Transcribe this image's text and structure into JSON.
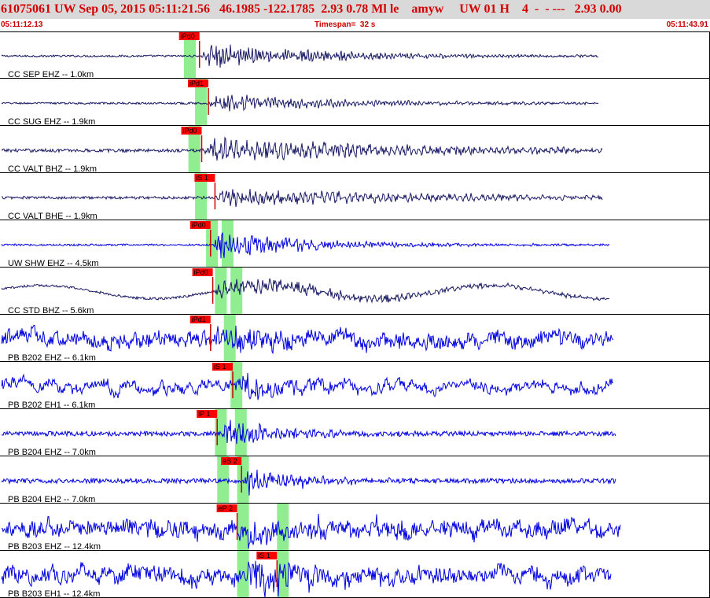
{
  "header": {
    "title": "61075061 UW Sep 05, 2015 05:11:21.56   46.1985 -122.1785  2.93 0.78 Ml le    amyw     UW 01 H    4  -  - ---   2.93 0.00"
  },
  "time_axis": {
    "start_time": "05:11:12.13",
    "timespan_label": "Timespan=  32 s",
    "end_time": "05:11:43.91",
    "span_seconds": 32
  },
  "colors": {
    "title_bg": "#d9d9d9",
    "title_text": "#d40000",
    "trace_blue": "#0000e0",
    "trace_navy": "#1a1a66",
    "pick_box": "#ff0000",
    "pick_line": "#cc0000",
    "window_green": "#90ee90"
  },
  "channels": [
    {
      "label": "CC SEP EHZ -- 1.0km",
      "trace_color": "navy",
      "pick": {
        "label": "iPd0",
        "t": 9.0
      },
      "onset": 9.0,
      "end": 27.0,
      "noise": 0.04,
      "sig": 0.45,
      "decay": 0.16,
      "freq": 6.0,
      "lp_amp": 0.0,
      "windows": [
        8.3
      ]
    },
    {
      "label": "CC SUG EHZ -- 1.9km",
      "trace_color": "navy",
      "pick": {
        "label": "iPd1",
        "t": 9.4
      },
      "onset": 9.4,
      "end": 27.0,
      "noise": 0.04,
      "sig": 0.35,
      "decay": 0.16,
      "freq": 6.0,
      "lp_amp": 0.0,
      "windows": [
        8.8
      ]
    },
    {
      "label": "CC VALT BHZ -- 1.9km",
      "trace_color": "navy",
      "pick": {
        "label": "iPd0",
        "t": 9.1
      },
      "onset": 9.1,
      "end": 27.2,
      "noise": 0.07,
      "sig": 0.45,
      "decay": 0.1,
      "freq": 4.0,
      "lp_amp": 0.0,
      "windows": [
        8.5
      ]
    },
    {
      "label": "CC VALT BHE -- 1.9km",
      "trace_color": "navy",
      "pick": {
        "label": "iS 1",
        "t": 9.7
      },
      "onset": 9.7,
      "end": 27.2,
      "noise": 0.06,
      "sig": 0.35,
      "decay": 0.1,
      "freq": 4.0,
      "lp_amp": 0.0,
      "windows": [
        8.8
      ]
    },
    {
      "label": "UW SHW EHZ -- 4.5km",
      "trace_color": "blue",
      "pick": {
        "label": "iPd0",
        "t": 9.5
      },
      "onset": 9.5,
      "end": 27.5,
      "noise": 0.04,
      "sig": 0.55,
      "decay": 0.22,
      "freq": 6.0,
      "lp_amp": 0.0,
      "windows": [
        9.3,
        10.0
      ]
    },
    {
      "label": "CC STD BHZ -- 5.6km",
      "trace_color": "navy",
      "pick": {
        "label": "iPd0",
        "t": 9.6
      },
      "onset": 9.6,
      "end": 27.5,
      "noise": 0.05,
      "sig": 0.35,
      "decay": 0.12,
      "freq": 4.0,
      "lp_amp": 0.28,
      "windows": [
        9.7,
        10.4
      ]
    },
    {
      "label": "PB B202 EHZ -- 6.1km",
      "trace_color": "blue",
      "pick": {
        "label": "iPd1",
        "t": 9.5
      },
      "onset": 9.6,
      "end": 27.7,
      "noise": 0.25,
      "sig": 0.55,
      "decay": 0.35,
      "freq": 5.0,
      "lp_amp": 0.0,
      "windows": [
        10.1
      ]
    },
    {
      "label": "PB B202 EH1 -- 6.1km",
      "trace_color": "blue",
      "pick": {
        "label": "iS 1",
        "t": 10.5
      },
      "onset": 10.5,
      "end": 27.7,
      "noise": 0.15,
      "sig": 0.55,
      "decay": 0.35,
      "freq": 5.0,
      "lp_amp": 0.0,
      "windows": [
        10.4
      ]
    },
    {
      "label": "PB B204 EHZ -- 7.0km",
      "trace_color": "blue",
      "pick": {
        "label": "iP 1",
        "t": 9.8
      },
      "onset": 9.9,
      "end": 27.8,
      "noise": 0.1,
      "sig": 0.55,
      "decay": 0.35,
      "freq": 5.0,
      "lp_amp": 0.0,
      "windows": [
        9.7,
        10.6
      ]
    },
    {
      "label": "PB B204 EH2 -- 7.0km",
      "trace_color": "blue",
      "pick": {
        "label": "eS 2",
        "t": 10.9
      },
      "onset": 10.9,
      "end": 27.8,
      "noise": 0.1,
      "sig": 0.55,
      "decay": 0.35,
      "freq": 5.0,
      "lp_amp": 0.0,
      "windows": [
        9.8,
        10.7
      ]
    },
    {
      "label": "PB B203 EHZ -- 12.4km",
      "trace_color": "blue",
      "pick": {
        "label": "eP 2",
        "t": 10.7
      },
      "onset": 10.7,
      "end": 28.0,
      "noise": 0.28,
      "sig": 0.6,
      "decay": 0.3,
      "freq": 5.0,
      "lp_amp": 0.0,
      "windows": [
        10.7,
        12.5
      ]
    },
    {
      "label": "PB B203 EH1 -- 12.4km",
      "trace_color": "blue",
      "pick": {
        "label": "iS 1",
        "t": 12.5
      },
      "onset": 11.0,
      "end": 27.6,
      "noise": 0.28,
      "sig": 0.6,
      "decay": 0.3,
      "freq": 5.0,
      "lp_amp": 0.0,
      "windows": [
        10.7,
        12.5
      ]
    }
  ]
}
